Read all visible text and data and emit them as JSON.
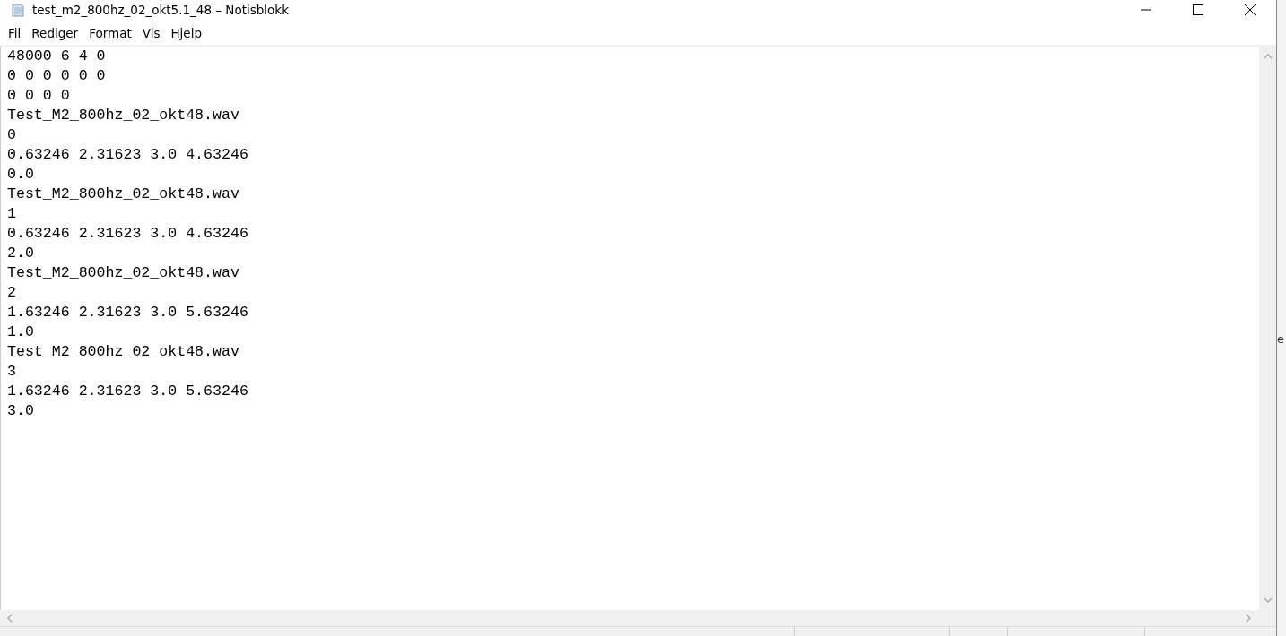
{
  "window": {
    "title": "test_m2_800hz_02_okt5.1_48 – Notisblokk"
  },
  "menu": [
    "Fil",
    "Rediger",
    "Format",
    "Vis",
    "Hjelp"
  ],
  "lines": [
    "48000 6 4 0",
    "0 0 0 0 0 0",
    "0 0 0 0",
    "Test_M2_800hz_02_okt48.wav",
    "0",
    "0.63246 2.31623 3.0 4.63246",
    "0.0",
    "Test_M2_800hz_02_okt48.wav",
    "1",
    "0.63246 2.31623 3.0 4.63246",
    "2.0",
    "Test_M2_800hz_02_okt48.wav",
    "2",
    "1.63246 2.31623 3.0 5.63246",
    "1.0",
    "Test_M2_800hz_02_okt48.wav",
    "3",
    "1.63246 2.31623 3.0 5.63246",
    "3.0"
  ],
  "background_text": "e"
}
